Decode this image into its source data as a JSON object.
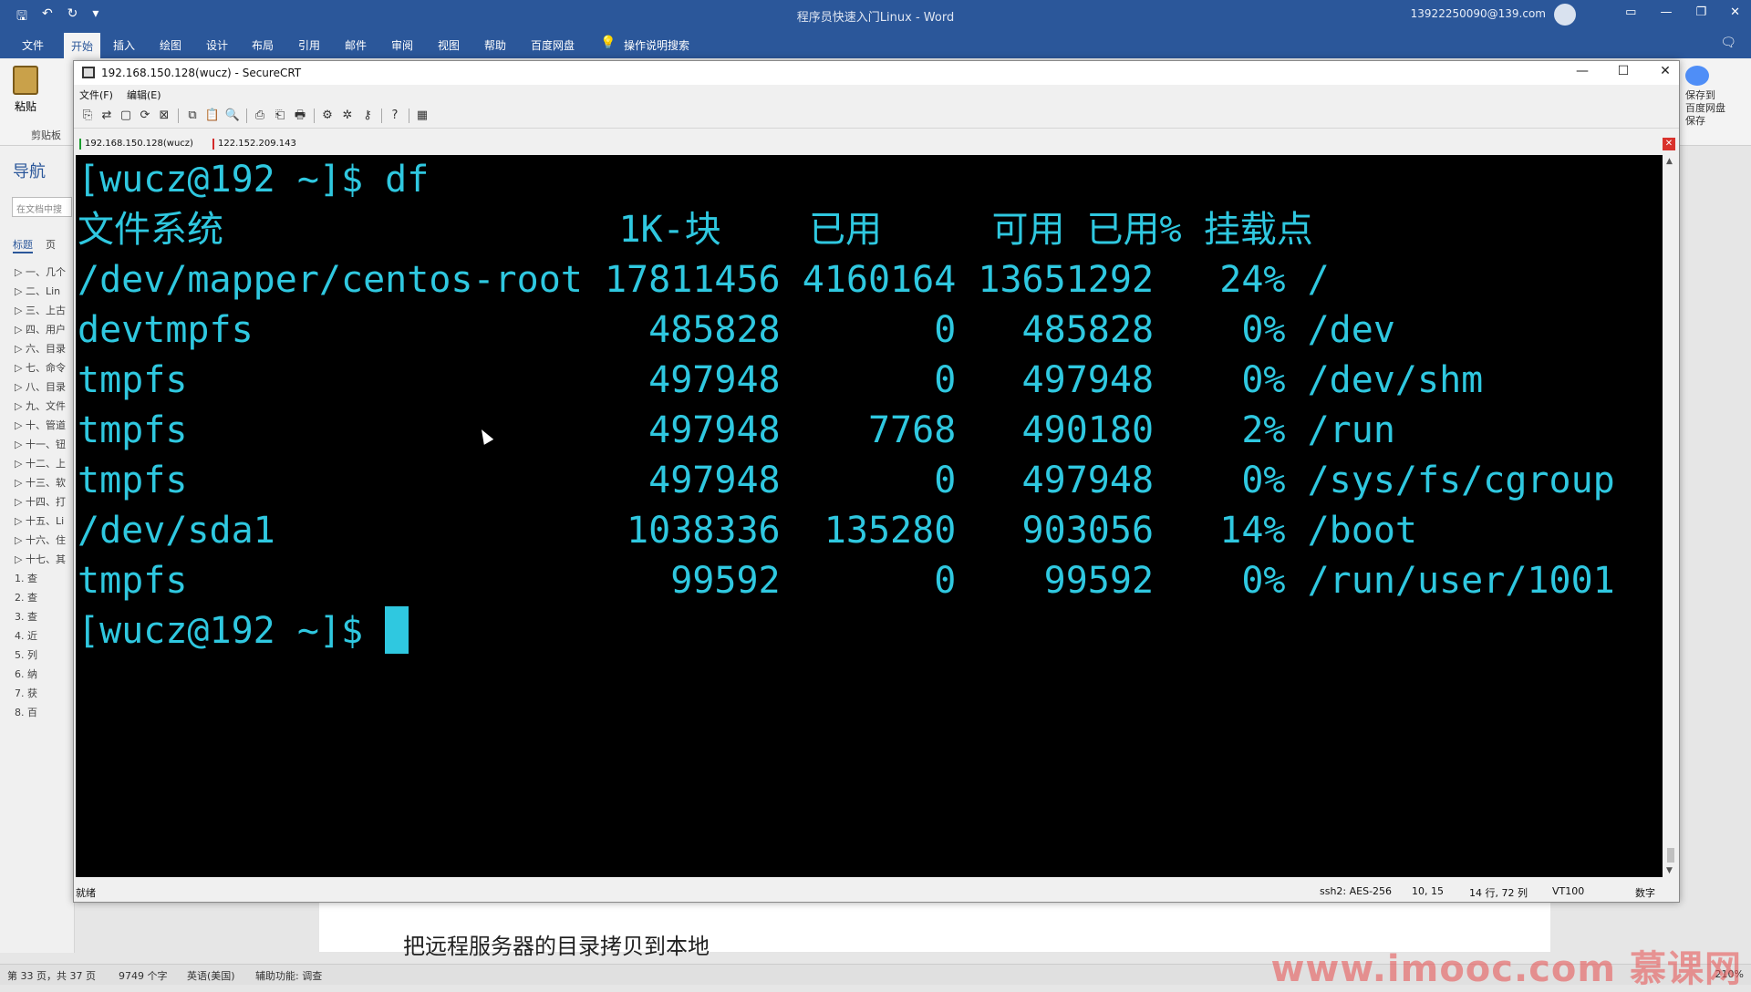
{
  "word": {
    "title": "程序员快速入门Linux  -  Word",
    "account": "13922250090@139.com",
    "tabs": [
      "文件",
      "开始",
      "插入",
      "绘图",
      "设计",
      "布局",
      "引用",
      "邮件",
      "审阅",
      "视图",
      "帮助",
      "百度网盘"
    ],
    "active_tab": "开始",
    "tell_me": "操作说明搜索",
    "paste_label": "粘贴",
    "clipboard_label": "剪贴板",
    "right_group_label": "保存到\n百度网盘\n保存",
    "nav": {
      "title": "导航",
      "search_placeholder": "在文档中搜",
      "tabs": [
        "标题",
        "页"
      ],
      "items": [
        "一、几个",
        "二、Lin",
        "三、上古",
        "四、用户",
        "六、目录",
        "七、命令",
        "八、目录",
        "九、文件",
        "十、管道",
        "十一、钮",
        "十二、上",
        "十三、软",
        "十四、打",
        "十五、Li",
        "十六、住",
        "十七、其",
        "1. 查",
        "2. 查",
        "3. 查",
        "4. 近",
        "5. 列",
        "6. 纳",
        "7. 获",
        "8. 百"
      ]
    },
    "doc_line": "把远程服务器的目录拷贝到本地",
    "status": {
      "page": "第 33 页，共 37 页",
      "words": "9749 个字",
      "lang": "英语(美国)",
      "access": "辅助功能: 调查",
      "zoom": "210%"
    },
    "watermark": "www.imooc.com 慕课网"
  },
  "crt": {
    "title": "192.168.150.128(wucz) - SecureCRT",
    "menus": [
      "文件(F)",
      "编辑(E)"
    ],
    "sessions": [
      "192.168.150.128(wucz)",
      "122.152.209.143"
    ],
    "terminal_lines": [
      "[wucz@192 ~]$ df",
      "文件系统                  1K-块    已用     可用 已用% 挂载点",
      "/dev/mapper/centos-root 17811456 4160164 13651292   24% /",
      "devtmpfs                  485828       0   485828    0% /dev",
      "tmpfs                     497948       0   497948    0% /dev/shm",
      "tmpfs                     497948    7768   490180    2% /run",
      "tmpfs                     497948       0   497948    0% /sys/fs/cgroup",
      "/dev/sda1                1038336  135280   903056   14% /boot",
      "tmpfs                      99592       0    99592    0% /run/user/1001"
    ],
    "prompt": "[wucz@192 ~]$ ",
    "status": {
      "ready": "就绪",
      "cipher": "ssh2: AES-256",
      "pos": "10,  15",
      "rowcol": "14 行, 72 列",
      "term": "VT100",
      "mode": "数字"
    },
    "colors": {
      "terminal_fg": "#2fc8e0",
      "terminal_bg": "#000000"
    }
  }
}
